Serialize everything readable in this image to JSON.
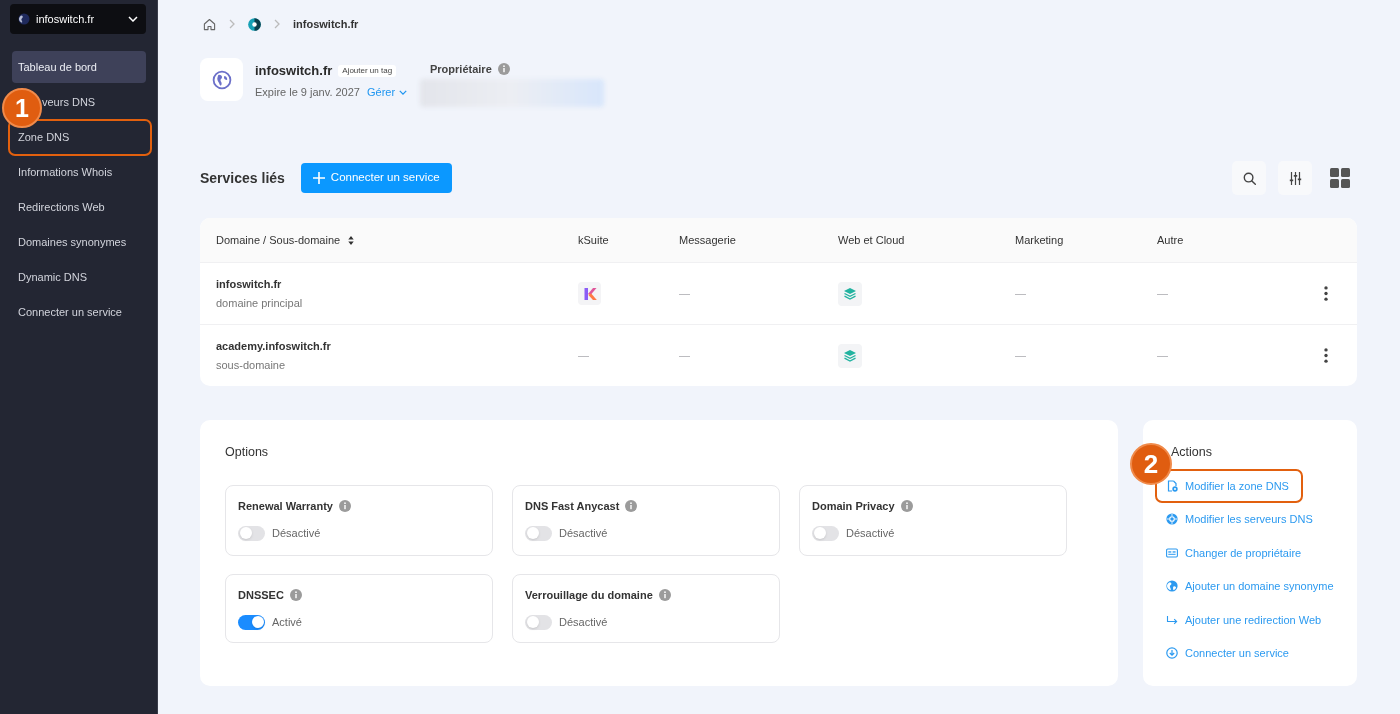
{
  "sidebar": {
    "domain_selector": {
      "label": "infoswitch.fr"
    },
    "items": [
      {
        "label": "Tableau de bord",
        "selected": true
      },
      {
        "label": "veurs DNS",
        "selected": false
      },
      {
        "label": "Zone DNS",
        "selected": false,
        "callout": "1"
      },
      {
        "label": "Informations Whois",
        "selected": false
      },
      {
        "label": "Redirections Web",
        "selected": false
      },
      {
        "label": "Domaines synonymes",
        "selected": false
      },
      {
        "label": "Dynamic DNS",
        "selected": false
      },
      {
        "label": "Connecter un service",
        "selected": false
      }
    ]
  },
  "breadcrumb": {
    "current": "infoswitch.fr"
  },
  "domain": {
    "name": "infoswitch.fr",
    "tag_button": "Ajouter un tag",
    "expiry": "Expire le 9 janv. 2027",
    "manage_link": "Gérer",
    "owner_label": "Propriétaire"
  },
  "services": {
    "title": "Services liés",
    "connect_button": "Connecter un service",
    "table": {
      "columns": [
        {
          "label": "Domaine / Sous-domaine",
          "sortable": true
        },
        {
          "label": "kSuite",
          "sortable": false
        },
        {
          "label": "Messagerie",
          "sortable": false
        },
        {
          "label": "Web et Cloud",
          "sortable": false
        },
        {
          "label": "Marketing",
          "sortable": false
        },
        {
          "label": "Autre",
          "sortable": false
        }
      ],
      "rows": [
        {
          "cells": [
            {
              "kind": "domain",
              "name": "infoswitch.fr",
              "type": "domaine principal"
            },
            {
              "kind": "ksuite"
            },
            {
              "kind": "empty",
              "text": "—"
            },
            {
              "kind": "hosting"
            },
            {
              "kind": "empty",
              "text": "—"
            },
            {
              "kind": "empty",
              "text": "—"
            }
          ]
        },
        {
          "cells": [
            {
              "kind": "domain",
              "name": "academy.infoswitch.fr",
              "type": "sous-domaine"
            },
            {
              "kind": "empty",
              "text": "—"
            },
            {
              "kind": "empty",
              "text": "—"
            },
            {
              "kind": "hosting"
            },
            {
              "kind": "empty",
              "text": "—"
            },
            {
              "kind": "empty",
              "text": "—"
            }
          ]
        }
      ]
    }
  },
  "options": {
    "title": "Options",
    "items": [
      {
        "label": "Renewal Warranty",
        "on": false,
        "status": "Désactivé"
      },
      {
        "label": "DNS Fast Anycast",
        "on": false,
        "status": "Désactivé"
      },
      {
        "label": "Domain Privacy",
        "on": false,
        "status": "Désactivé"
      },
      {
        "label": "DNSSEC",
        "on": true,
        "status": "Activé"
      },
      {
        "label": "Verrouillage du domaine",
        "on": false,
        "status": "Désactivé"
      }
    ]
  },
  "actions": {
    "title": "Actions",
    "items": [
      {
        "kind": "zone",
        "label": "Modifier la zone DNS",
        "callout": "2"
      },
      {
        "kind": "servers",
        "label": "Modifier les serveurs DNS"
      },
      {
        "kind": "owner",
        "label": "Changer de propriétaire"
      },
      {
        "kind": "alias",
        "label": "Ajouter un domaine synonyme"
      },
      {
        "kind": "redirect",
        "label": "Ajouter une redirection Web"
      },
      {
        "kind": "connect",
        "label": "Connecter un service"
      }
    ]
  }
}
